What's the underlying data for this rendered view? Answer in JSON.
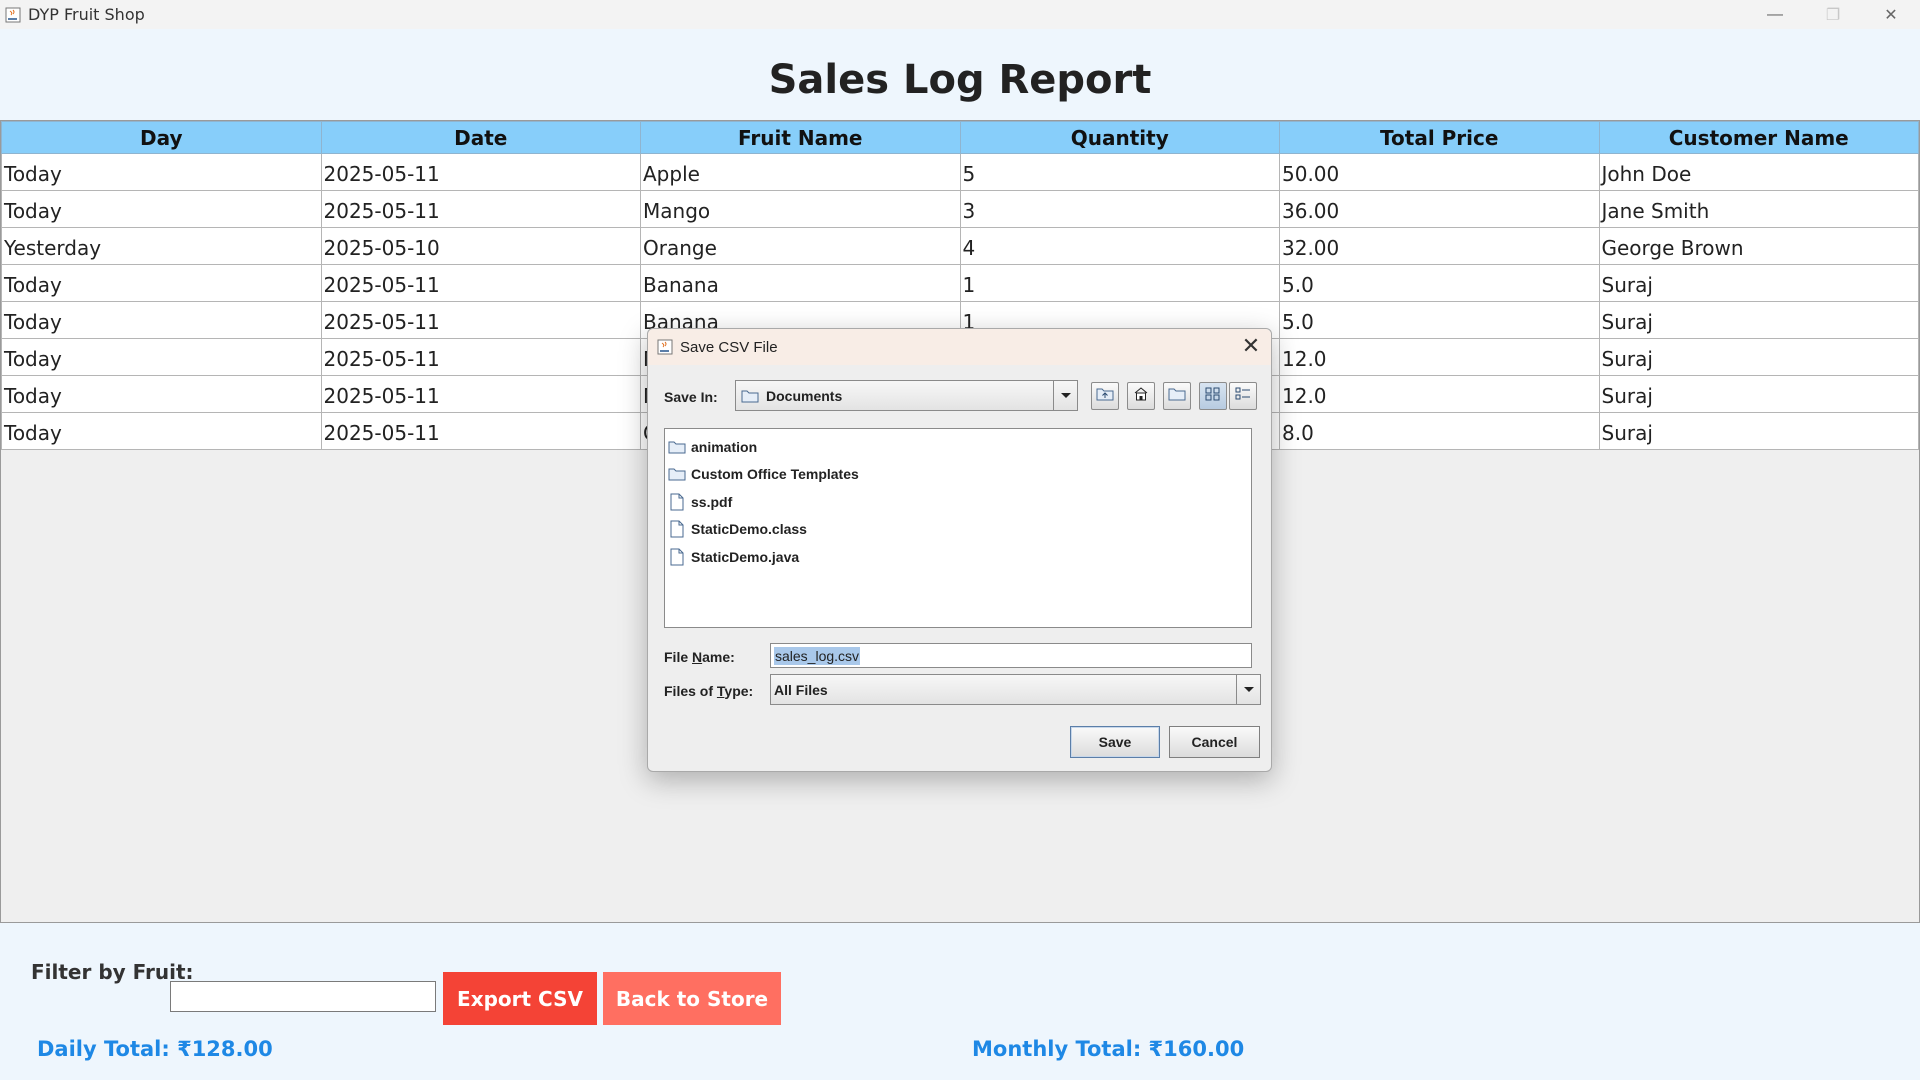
{
  "window": {
    "title": "DYP Fruit Shop",
    "minimize": "—",
    "maximize": "❐",
    "close": "✕"
  },
  "report": {
    "title": "Sales Log Report",
    "columns": [
      "Day",
      "Date",
      "Fruit Name",
      "Quantity",
      "Total Price",
      "Customer Name"
    ],
    "rows": [
      [
        "Today",
        "2025-05-11",
        "Apple",
        "5",
        "50.00",
        "John Doe"
      ],
      [
        "Today",
        "2025-05-11",
        "Mango",
        "3",
        "36.00",
        "Jane Smith"
      ],
      [
        "Yesterday",
        "2025-05-10",
        "Orange",
        "4",
        "32.00",
        "George Brown"
      ],
      [
        "Today",
        "2025-05-11",
        "Banana",
        "1",
        "5.0",
        "Suraj"
      ],
      [
        "Today",
        "2025-05-11",
        "Banana",
        "1",
        "5.0",
        "Suraj"
      ],
      [
        "Today",
        "2025-05-11",
        "M",
        "",
        "12.0",
        "Suraj"
      ],
      [
        "Today",
        "2025-05-11",
        "M",
        "",
        "12.0",
        "Suraj"
      ],
      [
        "Today",
        "2025-05-11",
        "O",
        "",
        "8.0",
        "Suraj"
      ]
    ]
  },
  "controls": {
    "filter_label": "Filter by Fruit:",
    "filter_value": "",
    "export_label": "Export CSV",
    "back_label": "Back to Store",
    "daily_total": "Daily Total: ₹128.00",
    "monthly_total": "Monthly Total: ₹160.00"
  },
  "dialog": {
    "title": "Save CSV File",
    "close": "✕",
    "save_in_label": "Save In:",
    "save_in_value": "Documents",
    "files": [
      {
        "name": "animation",
        "type": "folder"
      },
      {
        "name": "Custom Office Templates",
        "type": "folder"
      },
      {
        "name": "ss.pdf",
        "type": "file"
      },
      {
        "name": "StaticDemo.class",
        "type": "file"
      },
      {
        "name": "StaticDemo.java",
        "type": "file"
      }
    ],
    "file_name_label_pre": "File ",
    "file_name_label_u": "N",
    "file_name_label_post": "ame:",
    "file_name_value": "sales_log.csv",
    "file_type_label_pre": "Files of ",
    "file_type_label_u": "T",
    "file_type_label_post": "ype:",
    "file_type_value": "All Files",
    "save_label": "Save",
    "cancel_label": "Cancel"
  }
}
